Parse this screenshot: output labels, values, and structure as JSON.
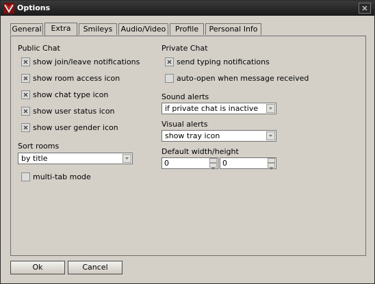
{
  "window": {
    "title": "Options"
  },
  "tabs": [
    {
      "label": "General"
    },
    {
      "label": "Extra"
    },
    {
      "label": "Smileys"
    },
    {
      "label": "Audio/Video"
    },
    {
      "label": "Profile"
    },
    {
      "label": "Personal Info"
    }
  ],
  "active_tab": "Extra",
  "public_chat": {
    "heading": "Public Chat",
    "options": [
      {
        "label": "show join/leave notifications",
        "checked": true
      },
      {
        "label": "show room access icon",
        "checked": true
      },
      {
        "label": "show chat type icon",
        "checked": true
      },
      {
        "label": "show user status icon",
        "checked": true
      },
      {
        "label": "show user gender icon",
        "checked": true
      }
    ]
  },
  "sort_rooms": {
    "label": "Sort rooms",
    "value": "by title"
  },
  "multi_tab": {
    "label": "multi-tab mode",
    "checked": false
  },
  "private_chat": {
    "heading": "Private Chat",
    "options": [
      {
        "label": "send typing notifications",
        "checked": true
      },
      {
        "label": "auto-open when message received",
        "checked": false
      }
    ]
  },
  "sound_alerts": {
    "label": "Sound alerts",
    "value": "if private chat is inactive"
  },
  "visual_alerts": {
    "label": "Visual alerts",
    "value": "show tray icon"
  },
  "default_size": {
    "label": "Default width/height",
    "width": "0",
    "height": "0"
  },
  "buttons": {
    "ok": "Ok",
    "cancel": "Cancel"
  }
}
